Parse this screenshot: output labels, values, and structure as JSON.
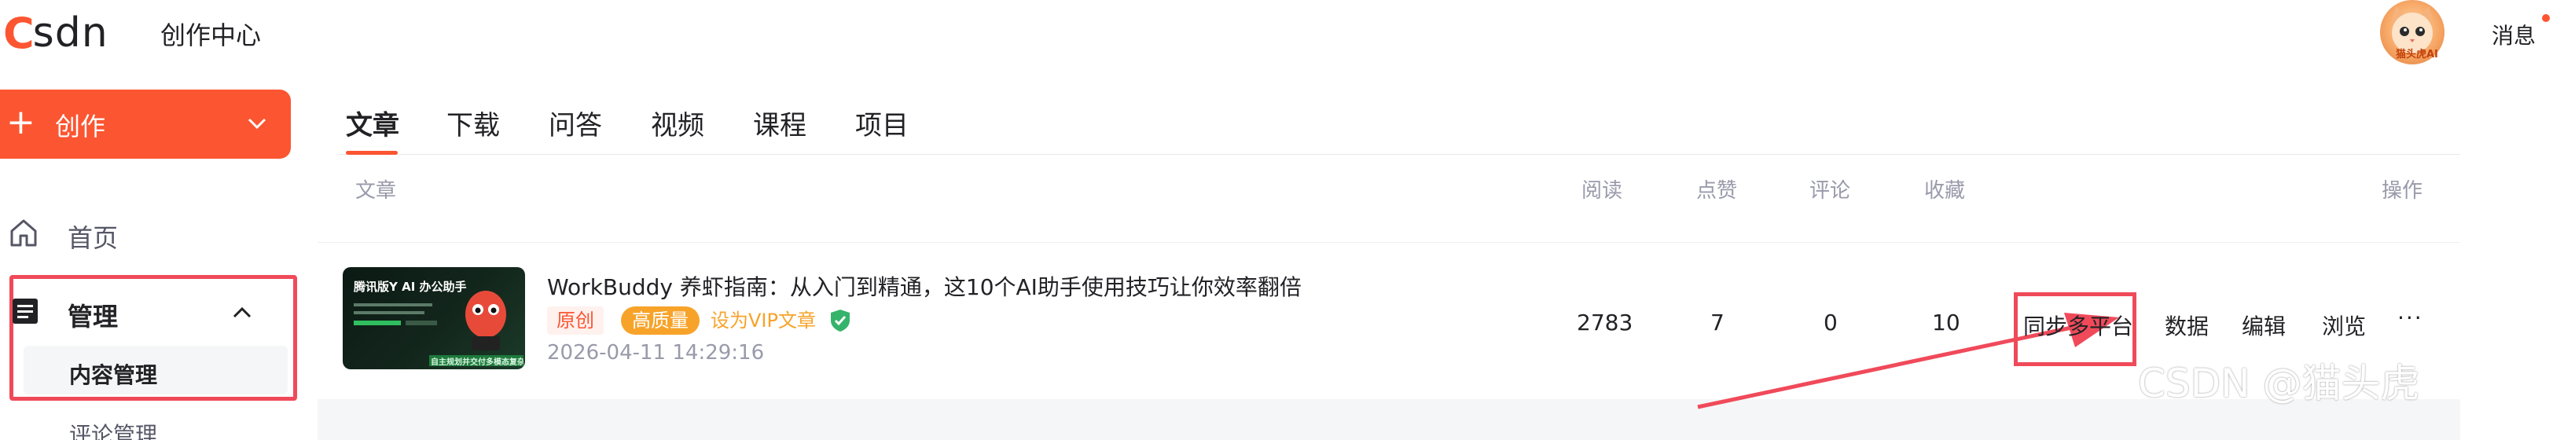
{
  "brand": {
    "logo_first": "C",
    "logo_rest": "SDN",
    "site_title": "创作中心",
    "accent_color": "#fc5531"
  },
  "header": {
    "avatar_caption": "猫头虎AI",
    "messages_label": "消息"
  },
  "sidebar": {
    "create_label": "创作",
    "items": [
      {
        "label": "首页",
        "icon": "home-icon"
      },
      {
        "label": "管理",
        "icon": "list-icon",
        "expanded": true,
        "children": [
          {
            "label": "内容管理",
            "active": true
          },
          {
            "label": "评论管理"
          }
        ]
      }
    ]
  },
  "tabs": [
    {
      "label": "文章",
      "active": true
    },
    {
      "label": "下载"
    },
    {
      "label": "问答"
    },
    {
      "label": "视频"
    },
    {
      "label": "课程"
    },
    {
      "label": "项目"
    }
  ],
  "table": {
    "columns": [
      "文章",
      "阅读",
      "点赞",
      "评论",
      "收藏",
      "操作"
    ],
    "rows": [
      {
        "thumbnail": {
          "title": "腾讯版Y AI 办公助手",
          "footer": "自主规划并交付多模态复杂任务"
        },
        "title": "WorkBuddy 养虾指南：从入门到精通，这10个AI助手使用技巧让你效率翻倍",
        "tags": [
          "原创",
          "高质量",
          "设为VIP文章"
        ],
        "date": "2026-04-11 14:29:16",
        "reads": "2783",
        "likes": "7",
        "comments": "0",
        "favorites": "10",
        "actions": [
          "同步多平台",
          "数据",
          "编辑",
          "浏览",
          "···"
        ]
      }
    ]
  },
  "annotation": {
    "highlight_color": "#f04a5a"
  },
  "watermark": "CSDN @猫头虎"
}
